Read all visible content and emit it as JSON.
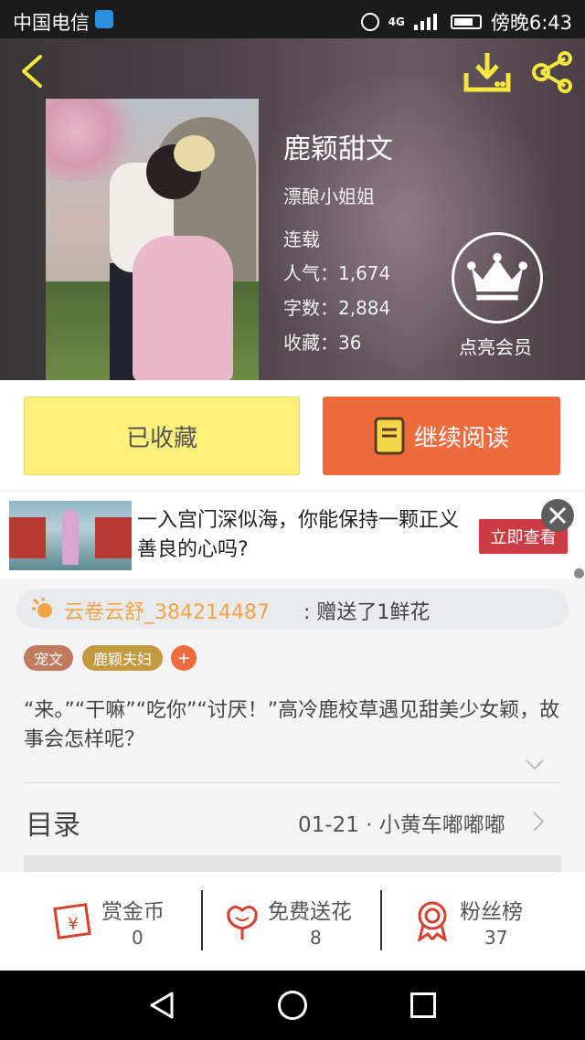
{
  "status_bar": {
    "carrier": "中国电信",
    "network": "4G",
    "time": "傍晚6:43"
  },
  "book": {
    "title": "鹿颖甜文",
    "author": "漂酿小姐姐",
    "status": "连载",
    "popularity": "人气：1,674",
    "word_count": "字数：2,884",
    "favorites": "收藏：36"
  },
  "vip": {
    "label": "点亮会员"
  },
  "actions": {
    "collected_label": "已收藏",
    "continue_label": "继续阅读"
  },
  "ad": {
    "text": "一入宫门深似海，你能保持一颗正义善良的心吗?",
    "button_label": "立即查看"
  },
  "gift_notice": {
    "user": "云卷云舒_384214487",
    "text": ": 赠送了1鲜花"
  },
  "tags": [
    "宠文",
    "鹿颖夫妇",
    "+"
  ],
  "synopsis": "“来。”“干嘛”“吃你”“讨厌！”高冷鹿校草遇见甜美少女颖，故事会怎样呢？",
  "catalog": {
    "label": "目录",
    "latest": "01-21 · 小黄车嘟嘟嘟"
  },
  "bottom_stats": [
    {
      "label": "赏金币",
      "value": "0",
      "icon": "red-envelope-icon"
    },
    {
      "label": "免费送花",
      "value": "8",
      "icon": "flower-icon"
    },
    {
      "label": "粉丝榜",
      "value": "37",
      "icon": "medal-icon"
    }
  ],
  "colors": {
    "accent_orange": "#ef6a3c",
    "collected_yellow": "#fdf07b",
    "icon_yellow": "#f5e642",
    "icon_red": "#d6402e",
    "ad_red": "#cd3b44",
    "gift_user_orange": "#f1a446"
  }
}
